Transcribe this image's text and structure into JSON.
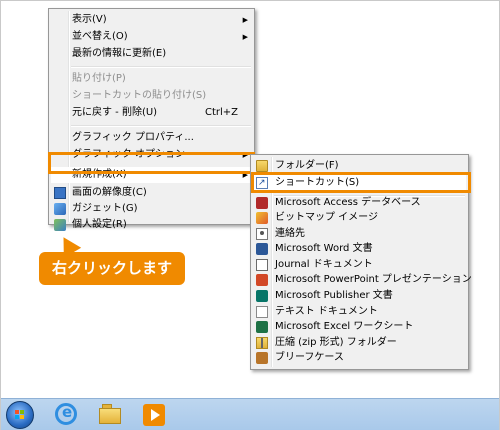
{
  "context_menu": {
    "items": [
      {
        "label": "表示(V)",
        "submenu": true
      },
      {
        "label": "並べ替え(O)",
        "submenu": true
      },
      {
        "label": "最新の情報に更新(E)"
      },
      {
        "label": "貼り付け(P)",
        "disabled": true
      },
      {
        "label": "ショートカットの貼り付け(S)",
        "disabled": true
      },
      {
        "label": "元に戻す - 削除(U)",
        "shortcut": "Ctrl+Z"
      },
      {
        "label": "グラフィック プロパティ..."
      },
      {
        "label": "グラフィック オプション",
        "submenu": true
      },
      {
        "label": "新規作成(X)",
        "submenu": true
      },
      {
        "label": "画面の解像度(C)",
        "icon": "screen-resolution-icon"
      },
      {
        "label": "ガジェット(G)",
        "icon": "gadget-icon"
      },
      {
        "label": "個人設定(R)",
        "icon": "personalize-icon"
      }
    ]
  },
  "new_submenu": {
    "items": [
      {
        "label": "フォルダー(F)",
        "icon": "folder-icon"
      },
      {
        "label": "ショートカット(S)",
        "icon": "shortcut-icon"
      },
      {
        "label": "Microsoft Access データベース",
        "icon": "access-icon"
      },
      {
        "label": "ビットマップ イメージ",
        "icon": "bitmap-icon"
      },
      {
        "label": "連絡先",
        "icon": "contact-icon"
      },
      {
        "label": "Microsoft Word 文書",
        "icon": "word-icon"
      },
      {
        "label": "Journal ドキュメント",
        "icon": "journal-icon"
      },
      {
        "label": "Microsoft PowerPoint プレゼンテーション",
        "icon": "powerpoint-icon"
      },
      {
        "label": "Microsoft Publisher 文書",
        "icon": "publisher-icon"
      },
      {
        "label": "テキスト ドキュメント",
        "icon": "text-document-icon"
      },
      {
        "label": "Microsoft Excel ワークシート",
        "icon": "excel-icon"
      },
      {
        "label": "圧縮 (zip 形式) フォルダー",
        "icon": "zip-folder-icon"
      },
      {
        "label": "ブリーフケース",
        "icon": "briefcase-icon"
      }
    ]
  },
  "callout": {
    "text": "右クリックします"
  },
  "highlight_color": "#f08a00",
  "taskbar": {
    "icons": [
      "start-icon",
      "internet-explorer-icon",
      "file-explorer-icon",
      "media-player-icon"
    ]
  }
}
